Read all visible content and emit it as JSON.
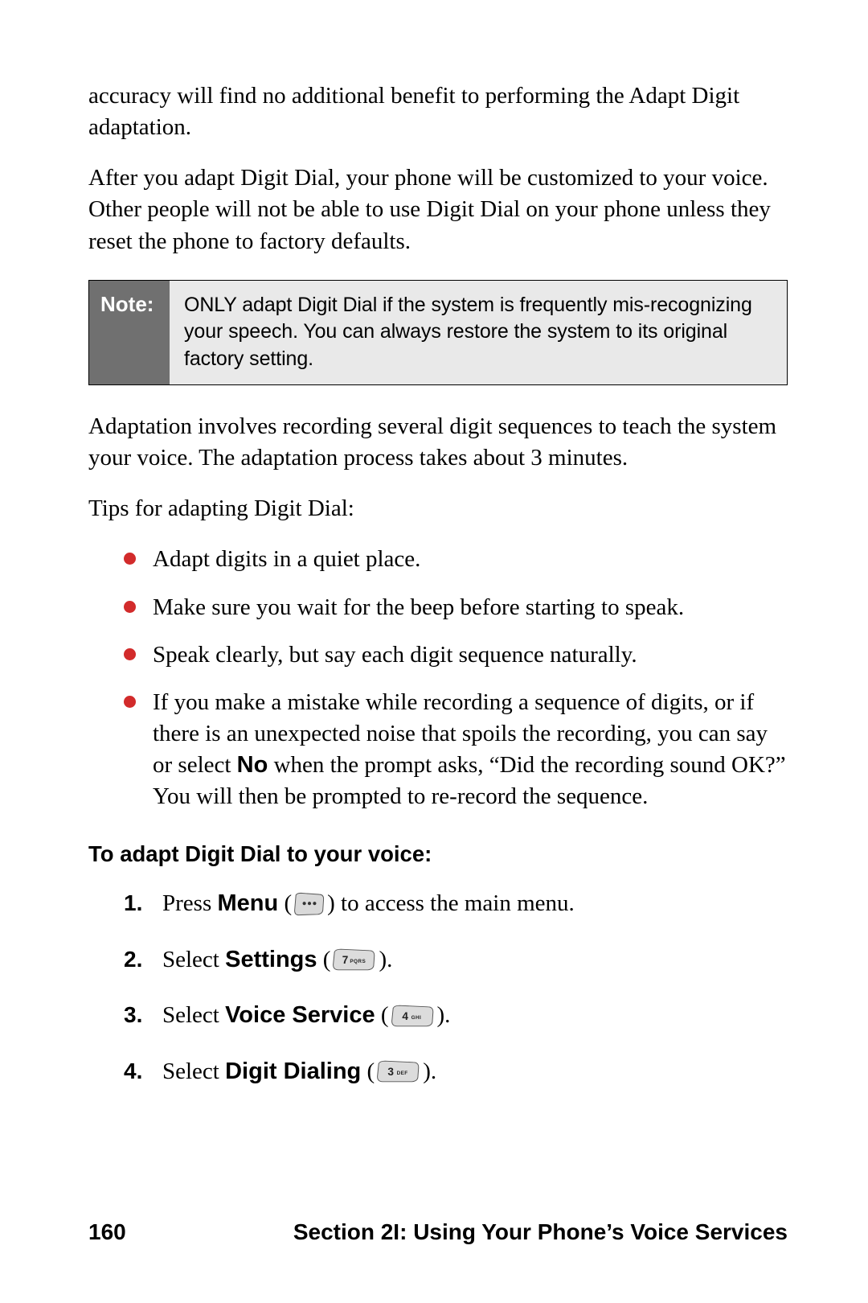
{
  "paragraphs": {
    "p1": "accuracy will find no additional benefit to performing the Adapt Digit adaptation.",
    "p2": "After you adapt Digit Dial, your phone will be customized to your voice. Other people will not be able to use Digit Dial on your phone unless they reset the phone to factory defaults.",
    "p3": "Adaptation involves recording several digit sequences to teach the system your voice. The adaptation process takes about 3 minutes.",
    "p4": "Tips for adapting Digit Dial:"
  },
  "note": {
    "label": "Note:",
    "body": "ONLY adapt Digit Dial if the system is frequently mis-recognizing your speech. You can always restore the system to its original factory setting."
  },
  "tips": [
    "Adapt digits in a quiet place.",
    "Make sure you wait for the beep before starting to speak.",
    "Speak clearly, but say each digit sequence naturally."
  ],
  "tip4": {
    "pre": "If you make a mistake while recording a sequence of digits, or if there is an unexpected noise that spoils the recording, you can say or select ",
    "bold": "No",
    "post": " when the prompt asks, “Did the recording sound OK?” You will then be prompted to re-record the sequence."
  },
  "subheading": "To adapt Digit Dial to your voice:",
  "steps": {
    "s1": {
      "pre": "Press ",
      "bold": "Menu",
      "paren_open": " (",
      "paren_close": ")",
      "tail": " to access the main menu."
    },
    "s2": {
      "pre": "Select ",
      "bold": "Settings",
      "paren_open": " (",
      "paren_close": ")."
    },
    "s3": {
      "pre": "Select ",
      "bold": "Voice Service",
      "paren_open": " (",
      "paren_close": ")."
    },
    "s4": {
      "pre": "Select ",
      "bold": "Digit Dialing",
      "paren_open": " (",
      "paren_close": ")."
    }
  },
  "keys": {
    "menu": "•••",
    "k7": "7 PQRS",
    "k4": "4 GHI",
    "k3": "3 DEF"
  },
  "footer": {
    "page": "160",
    "section": "Section 2I: Using Your Phone’s Voice Services"
  }
}
